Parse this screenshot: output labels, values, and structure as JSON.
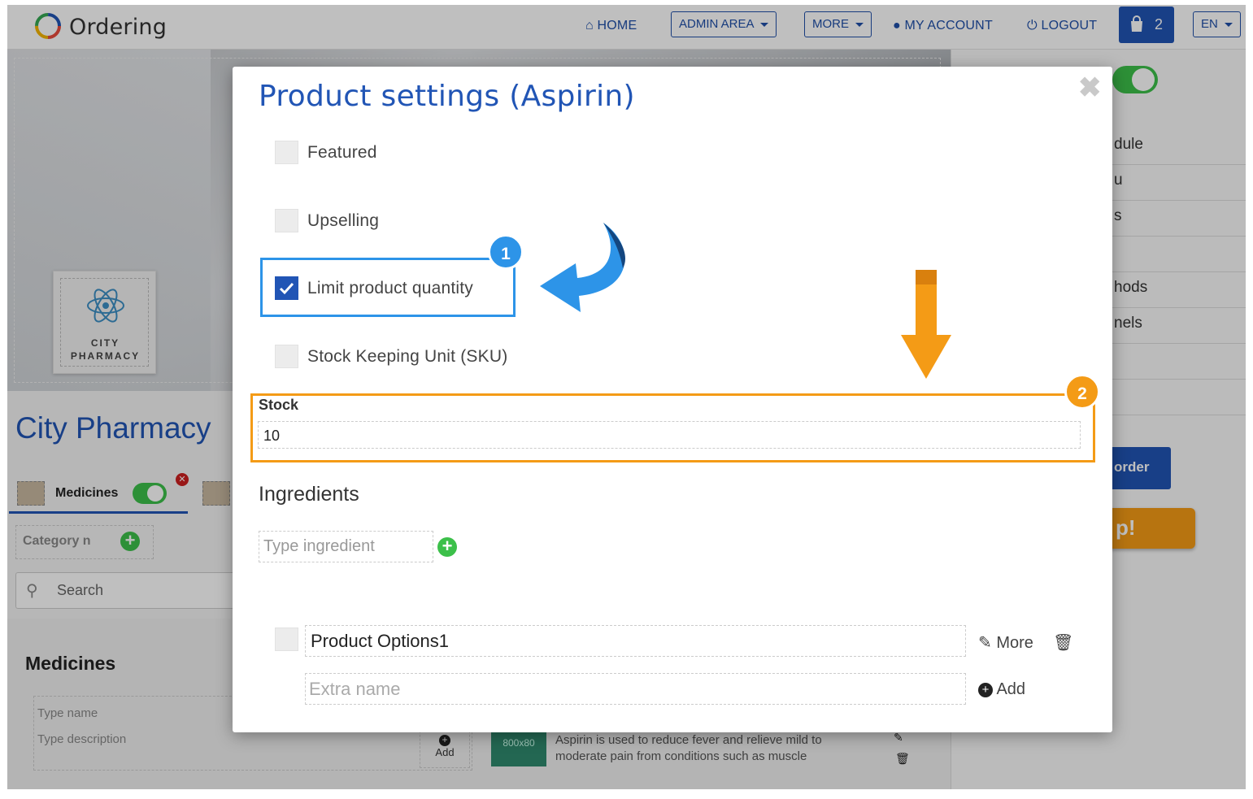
{
  "navbar": {
    "brand": "Ordering",
    "home": "HOME",
    "admin_area": "ADMIN AREA",
    "more": "MORE",
    "my_account": "MY ACCOUNT",
    "logout": "LOGOUT",
    "cart_count": "2",
    "language": "EN"
  },
  "background": {
    "logo_line1": "CITY",
    "logo_line2": "PHARMACY",
    "store_name": "City Pharmacy",
    "category_tab": "Medicines",
    "category_placeholder": "Category n",
    "search_placeholder": "Search",
    "section_title": "Medicines",
    "type_name_placeholder": "Type name",
    "type_description_placeholder": "Type description",
    "add_label": "Add",
    "product_description": "Aspirin is used to reduce fever and relieve mild to moderate pain from conditions such as muscle",
    "image_placeholder": "800x80",
    "right_menu": [
      "dule",
      "u",
      "s",
      "",
      "hods",
      "nels",
      "",
      ""
    ],
    "order_button": "order",
    "promo_button": "p!"
  },
  "modal": {
    "title": "Product settings (Aspirin)",
    "close": "✖",
    "options": [
      {
        "label": "Featured",
        "checked": false
      },
      {
        "label": "Upselling",
        "checked": false
      },
      {
        "label": "Limit product quantity",
        "checked": true
      },
      {
        "label": "Stock Keeping Unit (SKU)",
        "checked": false
      }
    ],
    "stock_label": "Stock",
    "stock_value": "10",
    "ingredients_title": "Ingredients",
    "ingredient_placeholder": "Type ingredient",
    "product_option_name": "Product Options1",
    "more_label": "More",
    "extra_placeholder": "Extra name",
    "add_label": "Add"
  },
  "annotations": {
    "badge1": "1",
    "badge2": "2",
    "badge1_color": "#2d94e8",
    "badge2_color": "#f49b16"
  },
  "colors": {
    "brand_blue": "#2155b5",
    "toggle_green": "#3cc04a",
    "highlight_blue": "#2d94e8",
    "highlight_orange": "#f49b16"
  }
}
